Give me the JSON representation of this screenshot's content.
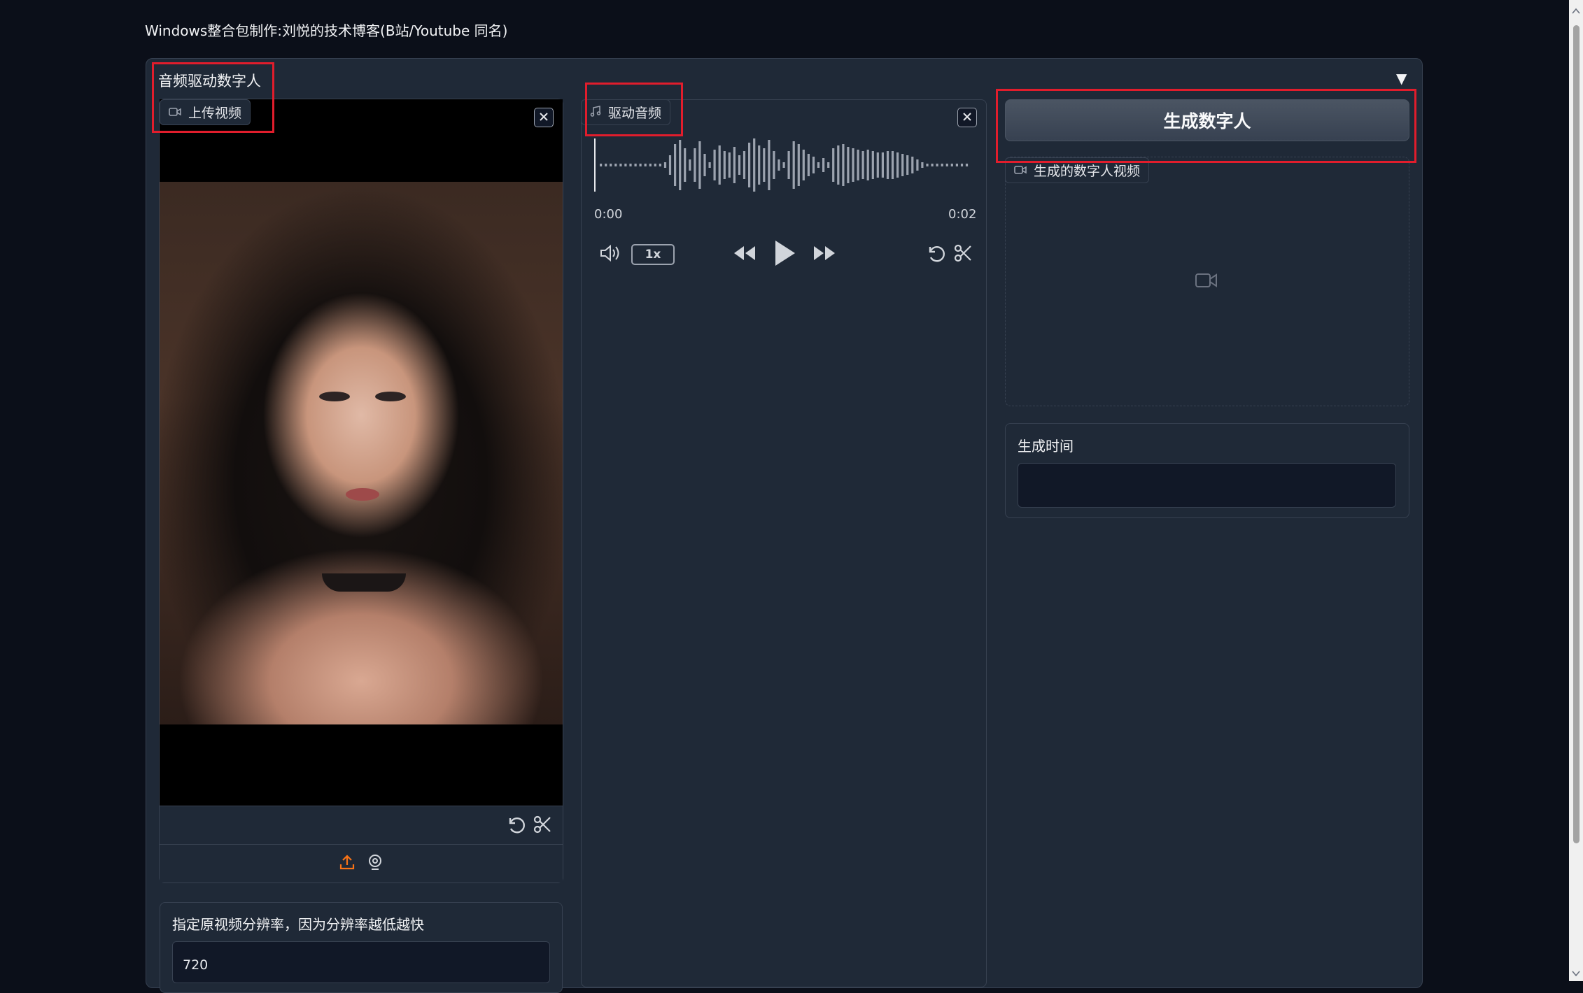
{
  "app": {
    "title": "Windows整合包制作:刘悦的技术博客(B站/Youtube 同名)"
  },
  "group": {
    "label": "音频驱动数字人",
    "collapse_symbol": "▼"
  },
  "video_input": {
    "label": "上传视频",
    "resolution_label": "指定原视频分辨率，因为分辨率越低越快",
    "resolution_value": "720"
  },
  "audio_input": {
    "label": "驱动音频",
    "current_time": "0:00",
    "duration": "0:02",
    "speed": "1x",
    "waveform_levels": [
      0.05,
      0.05,
      0.05,
      0.05,
      0.05,
      0.05,
      0.05,
      0.05,
      0.05,
      0.05,
      0.05,
      0.05,
      0.05,
      0.1,
      0.35,
      0.75,
      0.9,
      0.6,
      0.2,
      0.6,
      0.85,
      0.4,
      0.1,
      0.55,
      0.7,
      0.5,
      0.45,
      0.65,
      0.35,
      0.5,
      0.8,
      0.95,
      0.7,
      0.6,
      0.9,
      0.5,
      0.2,
      0.1,
      0.5,
      0.85,
      0.75,
      0.55,
      0.4,
      0.3,
      0.1,
      0.25,
      0.1,
      0.6,
      0.7,
      0.75,
      0.65,
      0.6,
      0.55,
      0.5,
      0.55,
      0.5,
      0.45,
      0.45,
      0.5,
      0.5,
      0.45,
      0.4,
      0.35,
      0.3,
      0.2,
      0.1,
      0.05,
      0.05,
      0.05,
      0.05,
      0.05,
      0.05,
      0.05,
      0.05,
      0.05
    ]
  },
  "output": {
    "generate_button": "生成数字人",
    "video_label": "生成的数字人视频",
    "time_label": "生成时间",
    "time_value": ""
  },
  "colors": {
    "background": "#0b0f19",
    "panel": "#1f2937",
    "highlight": "#e11d2c",
    "upload_accent": "#f97316"
  }
}
